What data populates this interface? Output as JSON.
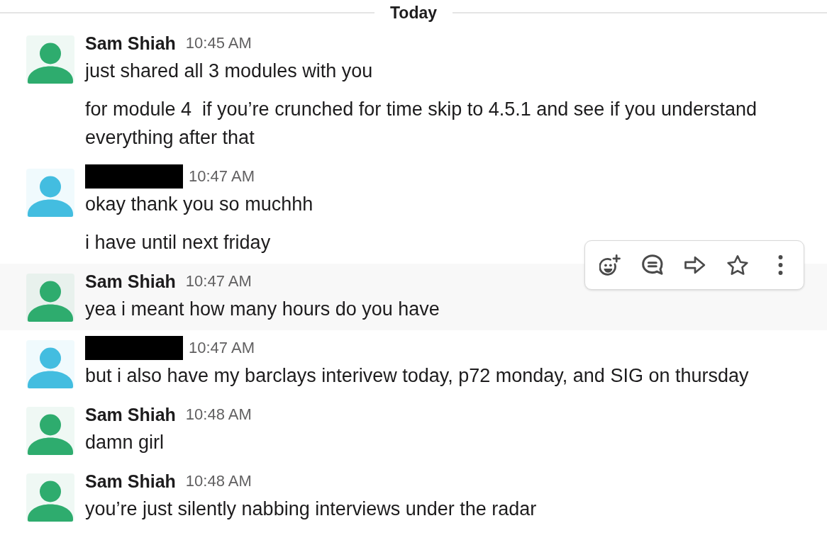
{
  "divider": {
    "label": "Today"
  },
  "messages": [
    {
      "redacted": false,
      "author": "Sam Shiah",
      "color": "#2eac6e",
      "time": "10:45 AM",
      "hovered": false,
      "paragraphs": [
        "just shared all 3 modules with you",
        "for module 4  if you’re crunched for time skip to 4.5.1 and see if you understand everything after that"
      ]
    },
    {
      "redacted": true,
      "color": "#43bde0",
      "time": "10:47 AM",
      "hovered": false,
      "paragraphs": [
        "okay thank you so muchhh",
        "i have until next friday"
      ]
    },
    {
      "redacted": false,
      "author": "Sam Shiah",
      "color": "#2eac6e",
      "time": "10:47 AM",
      "hovered": true,
      "paragraphs": [
        "yea i meant how many hours do you have"
      ]
    },
    {
      "redacted": true,
      "color": "#43bde0",
      "time": "10:47 AM",
      "hovered": false,
      "paragraphs": [
        "but i also have my barclays interivew today, p72 monday, and SIG on thursday"
      ]
    },
    {
      "redacted": false,
      "author": "Sam Shiah",
      "color": "#2eac6e",
      "time": "10:48 AM",
      "hovered": false,
      "paragraphs": [
        "damn girl"
      ]
    },
    {
      "redacted": false,
      "author": "Sam Shiah",
      "color": "#2eac6e",
      "time": "10:48 AM",
      "hovered": false,
      "paragraphs": [
        "you’re just silently nabbing interviews under the radar"
      ]
    }
  ]
}
